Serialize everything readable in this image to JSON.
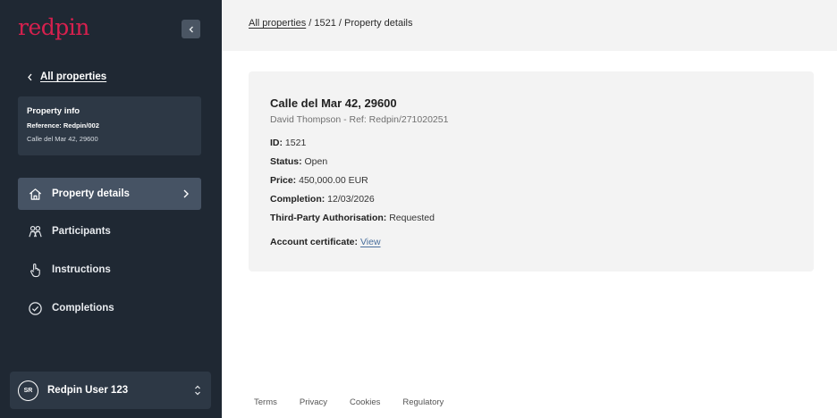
{
  "brand": {
    "logo_text": "redpin",
    "accent": "#d6204e"
  },
  "sidebar": {
    "back_label": "All properties",
    "info": {
      "title": "Property info",
      "reference": "Reference: Redpin/002",
      "address": "Calle del Mar 42, 29600"
    },
    "nav": [
      {
        "label": "Property details",
        "icon": "home-icon",
        "active": true
      },
      {
        "label": "Participants",
        "icon": "people-icon",
        "active": false
      },
      {
        "label": "Instructions",
        "icon": "hand-pointer-icon",
        "active": false
      },
      {
        "label": "Completions",
        "icon": "check-circle-icon",
        "active": false
      }
    ],
    "user": {
      "initials": "SR",
      "name": "Redpin User 123"
    }
  },
  "breadcrumb": {
    "root": "All properties",
    "sep": " / ",
    "id": "1521",
    "current": "Property details"
  },
  "property": {
    "address": "Calle del Mar 42, 29600",
    "subtitle": "David Thompson - Ref: Redpin/271020251",
    "fields": [
      {
        "label": "ID:",
        "value": "1521"
      },
      {
        "label": "Status:",
        "value": "Open"
      },
      {
        "label": "Price:",
        "value": "450,000.00 EUR"
      },
      {
        "label": "Completion:",
        "value": "12/03/2026"
      },
      {
        "label": "Third-Party Authorisation:",
        "value": "Requested"
      }
    ],
    "certificate": {
      "label": "Account certificate:",
      "link": "View"
    }
  },
  "footer": {
    "links": [
      "Terms",
      "Privacy",
      "Cookies",
      "Regulatory"
    ]
  }
}
